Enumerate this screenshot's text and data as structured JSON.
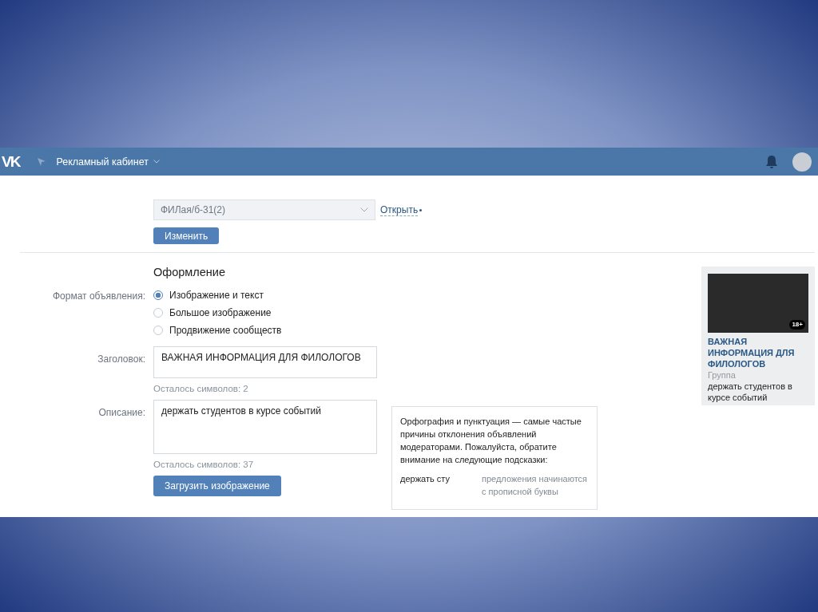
{
  "header": {
    "logo": "VK",
    "title": "Рекламный кабинет"
  },
  "campaign": {
    "value": "ФИЛая/б-31(2)",
    "link": "Открыть",
    "button": "Изменить"
  },
  "design": {
    "heading": "Оформление",
    "format_label": "Формат объявления:",
    "formats": [
      {
        "label": "Изображение и текст",
        "selected": true
      },
      {
        "label": "Большое изображение",
        "selected": false
      },
      {
        "label": "Продвижение сообществ",
        "selected": false
      }
    ],
    "title_label": "Заголовок:",
    "title_value": "ВАЖНАЯ ИНФОРМАЦИЯ ДЛЯ ФИЛОЛОГОВ",
    "title_remaining": "Осталось символов: 2",
    "description_label": "Описание:",
    "description_value": "держать студентов в курсе событий",
    "description_remaining": "Осталось символов: 37",
    "upload_button": "Загрузить изображение"
  },
  "hint": {
    "text": "Орфография и пунктуация — самые частые причины отклонения объявлений модераторами. Пожалуйста, обратите внимание на следующие подсказки:",
    "word": "держать сту",
    "advice": "предложения начинаются с прописной буквы"
  },
  "preview": {
    "badge": "18+",
    "title": "ВАЖНАЯ ИНФОРМАЦИЯ ДЛЯ ФИЛОЛОГОВ",
    "type": "Группа",
    "description": "держать студентов в курсе событий"
  }
}
